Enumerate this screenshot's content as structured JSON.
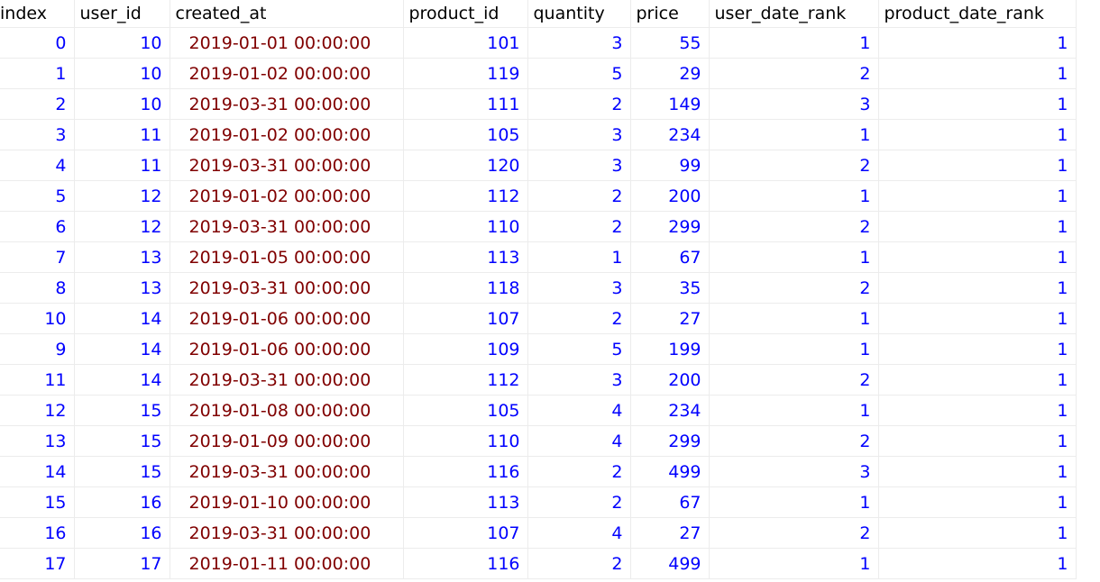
{
  "columns": [
    "index",
    "user_id",
    "created_at",
    "product_id",
    "quantity",
    "price",
    "user_date_rank",
    "product_date_rank"
  ],
  "rows": [
    [
      "0",
      "10",
      "2019-01-01 00:00:00",
      "101",
      "3",
      "55",
      "1",
      "1"
    ],
    [
      "1",
      "10",
      "2019-01-02 00:00:00",
      "119",
      "5",
      "29",
      "2",
      "1"
    ],
    [
      "2",
      "10",
      "2019-03-31 00:00:00",
      "111",
      "2",
      "149",
      "3",
      "1"
    ],
    [
      "3",
      "11",
      "2019-01-02 00:00:00",
      "105",
      "3",
      "234",
      "1",
      "1"
    ],
    [
      "4",
      "11",
      "2019-03-31 00:00:00",
      "120",
      "3",
      "99",
      "2",
      "1"
    ],
    [
      "5",
      "12",
      "2019-01-02 00:00:00",
      "112",
      "2",
      "200",
      "1",
      "1"
    ],
    [
      "6",
      "12",
      "2019-03-31 00:00:00",
      "110",
      "2",
      "299",
      "2",
      "1"
    ],
    [
      "7",
      "13",
      "2019-01-05 00:00:00",
      "113",
      "1",
      "67",
      "1",
      "1"
    ],
    [
      "8",
      "13",
      "2019-03-31 00:00:00",
      "118",
      "3",
      "35",
      "2",
      "1"
    ],
    [
      "10",
      "14",
      "2019-01-06 00:00:00",
      "107",
      "2",
      "27",
      "1",
      "1"
    ],
    [
      "9",
      "14",
      "2019-01-06 00:00:00",
      "109",
      "5",
      "199",
      "1",
      "1"
    ],
    [
      "11",
      "14",
      "2019-03-31 00:00:00",
      "112",
      "3",
      "200",
      "2",
      "1"
    ],
    [
      "12",
      "15",
      "2019-01-08 00:00:00",
      "105",
      "4",
      "234",
      "1",
      "1"
    ],
    [
      "13",
      "15",
      "2019-01-09 00:00:00",
      "110",
      "4",
      "299",
      "2",
      "1"
    ],
    [
      "14",
      "15",
      "2019-03-31 00:00:00",
      "116",
      "2",
      "499",
      "3",
      "1"
    ],
    [
      "15",
      "16",
      "2019-01-10 00:00:00",
      "113",
      "2",
      "67",
      "1",
      "1"
    ],
    [
      "16",
      "16",
      "2019-03-31 00:00:00",
      "107",
      "4",
      "27",
      "2",
      "1"
    ],
    [
      "17",
      "17",
      "2019-01-11 00:00:00",
      "116",
      "2",
      "499",
      "1",
      "1"
    ]
  ],
  "colors": {
    "number": "#0000ff",
    "date": "#800000"
  }
}
